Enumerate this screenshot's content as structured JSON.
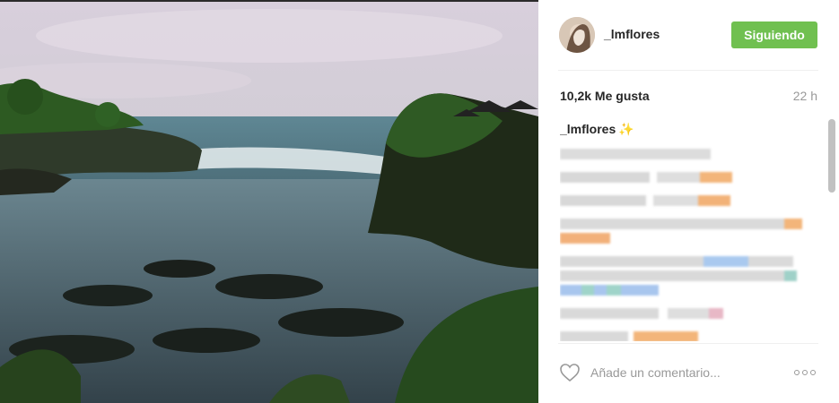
{
  "post": {
    "username": "_lmflores",
    "follow_label": "Siguiendo",
    "likes": "10,2k Me gusta",
    "time": "22 h",
    "caption_user": "_lmflores",
    "caption_emoji": "✨",
    "comment_placeholder": "Añade un comentario...",
    "colors": {
      "follow_button": "#70c050",
      "text": "#262626",
      "muted": "#999999"
    }
  },
  "icons": {
    "heart": "heart-icon",
    "more": "more-options-icon"
  }
}
